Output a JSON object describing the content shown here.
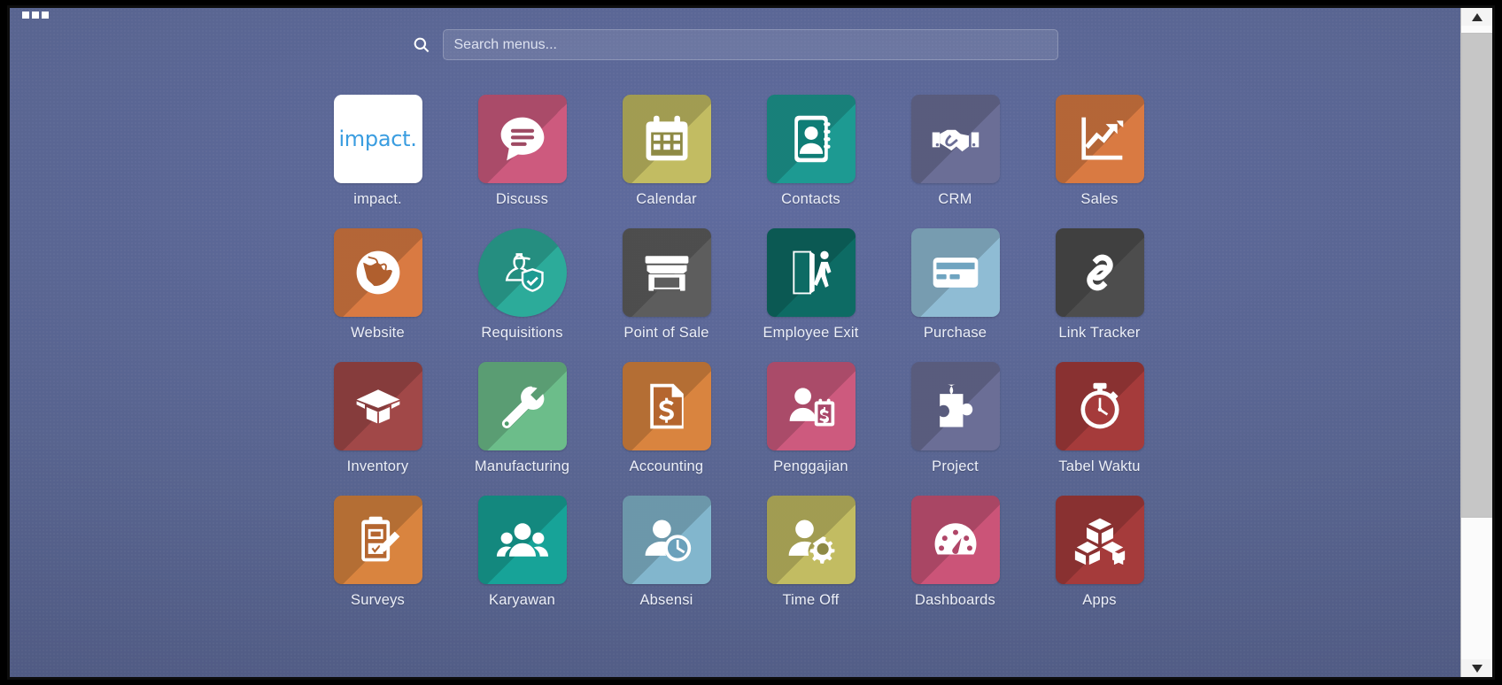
{
  "window": {
    "title": "impact. Apps Menu",
    "background_color": "#58648f"
  },
  "top_bar": {
    "apps_grid_icon": "apps-grid-icon",
    "squares": 3
  },
  "search": {
    "icon": "search-icon",
    "placeholder": "Search menus...",
    "value": ""
  },
  "apps": [
    {
      "label": "impact.",
      "icon": "impact-logo",
      "logo_text": "impact.",
      "color": "#ffffff",
      "shape": "logo",
      "text_color": "#3a9de0"
    },
    {
      "label": "Discuss",
      "icon": "speech-bubble-icon",
      "color": "#cd5a7e",
      "shape": "square"
    },
    {
      "label": "Calendar",
      "icon": "calendar-icon",
      "color": "#c2bc62",
      "shape": "square"
    },
    {
      "label": "Contacts",
      "icon": "address-book-icon",
      "color": "#1d9a92",
      "shape": "square"
    },
    {
      "label": "CRM",
      "icon": "handshake-icon",
      "color": "#6b6e96",
      "shape": "square"
    },
    {
      "label": "Sales",
      "icon": "growth-chart-icon",
      "color": "#d97a42",
      "shape": "square"
    },
    {
      "label": "Website",
      "icon": "globe-icon",
      "color": "#d97a42",
      "shape": "square"
    },
    {
      "label": "Requisitions",
      "icon": "person-shield-icon",
      "color": "#2cab9a",
      "shape": "circle"
    },
    {
      "label": "Point of Sale",
      "icon": "storefront-icon",
      "color": "#5d5d5d",
      "shape": "square"
    },
    {
      "label": "Employee Exit",
      "icon": "door-exit-icon",
      "color": "#0d6b64",
      "shape": "square"
    },
    {
      "label": "Purchase",
      "icon": "credit-card-icon",
      "color": "#8fbcd4",
      "shape": "square"
    },
    {
      "label": "Link Tracker",
      "icon": "chain-link-icon",
      "color": "#4d4d4d",
      "shape": "square"
    },
    {
      "label": "Inventory",
      "icon": "open-box-icon",
      "color": "#a14848",
      "shape": "square"
    },
    {
      "label": "Manufacturing",
      "icon": "wrench-icon",
      "color": "#6cbd8a",
      "shape": "square"
    },
    {
      "label": "Accounting",
      "icon": "invoice-dollar-icon",
      "color": "#d9843f",
      "shape": "square"
    },
    {
      "label": "Penggajian",
      "icon": "payroll-person-icon",
      "color": "#cd5a7e",
      "shape": "square"
    },
    {
      "label": "Project",
      "icon": "puzzle-piece-icon",
      "color": "#6b6e96",
      "shape": "square"
    },
    {
      "label": "Tabel Waktu",
      "icon": "stopwatch-icon",
      "color": "#a53b3b",
      "shape": "square"
    },
    {
      "label": "Surveys",
      "icon": "clipboard-pencil-icon",
      "color": "#d9843f",
      "shape": "square"
    },
    {
      "label": "Karyawan",
      "icon": "people-group-icon",
      "color": "#17a398",
      "shape": "square"
    },
    {
      "label": "Absensi",
      "icon": "person-clock-icon",
      "color": "#82b6cd",
      "shape": "square"
    },
    {
      "label": "Time Off",
      "icon": "person-gear-icon",
      "color": "#c2bc62",
      "shape": "square"
    },
    {
      "label": "Dashboards",
      "icon": "gauge-icon",
      "color": "#cb5478",
      "shape": "square"
    },
    {
      "label": "Apps",
      "icon": "boxes-icon",
      "color": "#a53b3b",
      "shape": "square"
    }
  ],
  "scrollbar": {
    "up_arrow": "scroll-up-arrow-icon",
    "down_arrow": "scroll-down-arrow-icon",
    "thumb": "scrollbar-thumb"
  }
}
